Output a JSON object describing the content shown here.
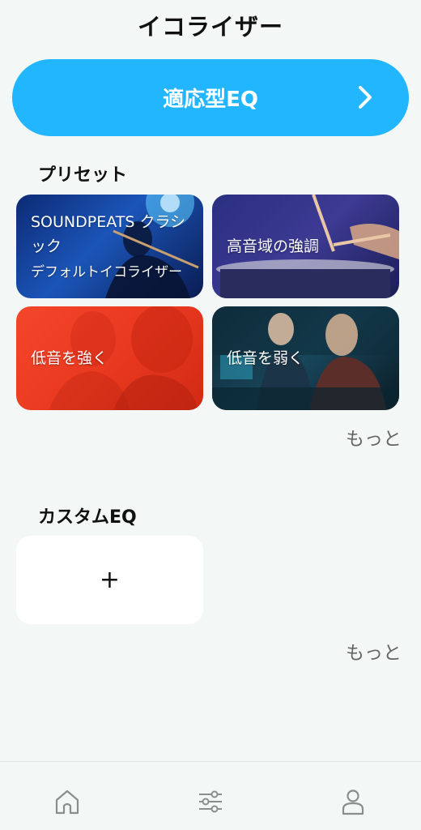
{
  "header": {
    "title": "イコライザー"
  },
  "adaptive": {
    "label": "適応型EQ"
  },
  "presets": {
    "title": "プリセット",
    "cards": [
      {
        "line1": "SOUNDPEATS クラシ",
        "line2": "ック",
        "line3": "デフォルトイコライザー"
      },
      {
        "label": "高音域の強調"
      },
      {
        "label": "低音を強く"
      },
      {
        "label": "低音を弱く"
      }
    ],
    "more_label": "もっと"
  },
  "custom": {
    "title": "カスタムEQ",
    "add_label": "+",
    "more_label": "もっと"
  },
  "nav": {
    "icons": [
      "home-icon",
      "equalizer-icon",
      "profile-icon"
    ]
  },
  "colors": {
    "accent": "#21b6ff",
    "background": "#f3f8f6"
  }
}
